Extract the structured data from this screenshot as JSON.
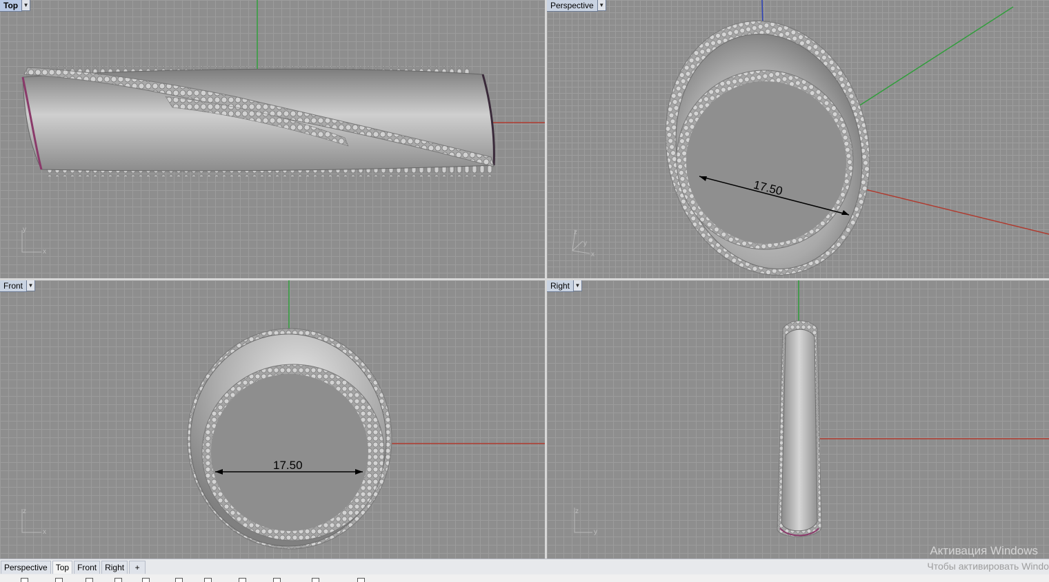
{
  "viewports": {
    "top": {
      "title": "Top",
      "axis_a": "y",
      "axis_b": "x"
    },
    "perspective": {
      "title": "Perspective",
      "axis_a": "z",
      "axis_b": "y",
      "axis_c": "x",
      "dimension": "17.50"
    },
    "front": {
      "title": "Front",
      "axis_a": "z",
      "axis_b": "x",
      "dimension": "17.50"
    },
    "right": {
      "title": "Right",
      "axis_a": "z",
      "axis_b": "y"
    }
  },
  "tabs": [
    "Perspective",
    "Top",
    "Front",
    "Right"
  ],
  "add_tab_symbol": "+",
  "watermark": {
    "line1": "Активация Windows",
    "line2": "Чтобы активировать Window"
  },
  "colors": {
    "x_axis": "#b03a2e",
    "y_axis": "#2f9e3a",
    "z_axis": "#2a3fb8",
    "model": "#b4b4b4",
    "grid_bg": "#8e8e8e"
  }
}
